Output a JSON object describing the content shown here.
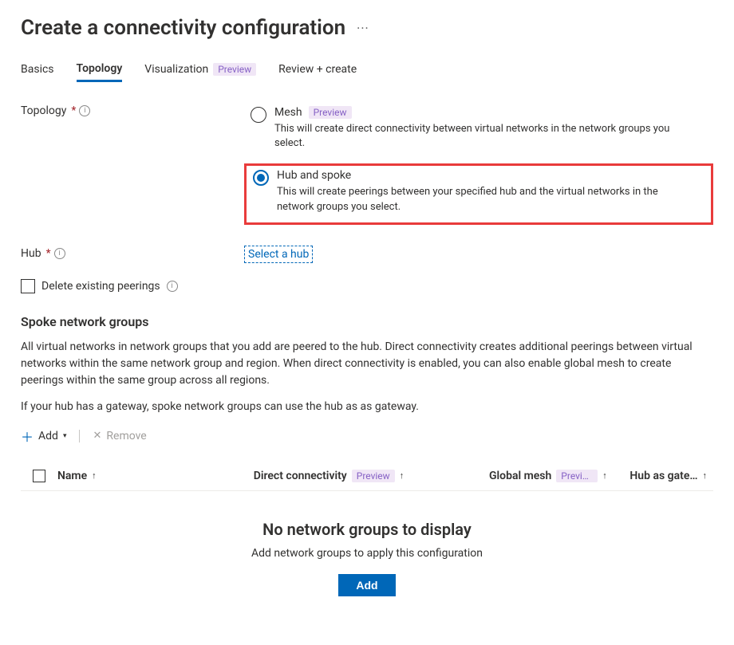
{
  "header": {
    "title": "Create a connectivity configuration"
  },
  "tabs": {
    "basics": "Basics",
    "topology": "Topology",
    "visualization": "Visualization",
    "visualization_badge": "Preview",
    "review": "Review + create"
  },
  "topology": {
    "label": "Topology",
    "options": {
      "mesh": {
        "title": "Mesh",
        "badge": "Preview",
        "desc": "This will create direct connectivity between virtual networks in the network groups you select."
      },
      "hubspoke": {
        "title": "Hub and spoke",
        "desc": "This will create peerings between your specified hub and the virtual networks in the network groups you select."
      }
    }
  },
  "hub": {
    "label": "Hub",
    "select_link": "Select a hub"
  },
  "delete_peerings": {
    "label": "Delete existing peerings"
  },
  "spoke_section": {
    "title": "Spoke network groups",
    "desc1": "All virtual networks in network groups that you add are peered to the hub. Direct connectivity creates additional peerings between virtual networks within the same network group and region. When direct connectivity is enabled, you can also enable global mesh to create peerings within the same group across all regions.",
    "desc2": "If your hub has a gateway, spoke network groups can use the hub as as gateway."
  },
  "toolbar": {
    "add": "Add",
    "remove": "Remove"
  },
  "table": {
    "cols": {
      "name": "Name",
      "direct": "Direct connectivity",
      "direct_badge": "Preview",
      "global": "Global mesh",
      "global_badge": "Previe…",
      "hub_gw": "Hub as gate…"
    }
  },
  "empty": {
    "title": "No network groups to display",
    "sub": "Add network groups to apply this configuration",
    "add_btn": "Add"
  }
}
